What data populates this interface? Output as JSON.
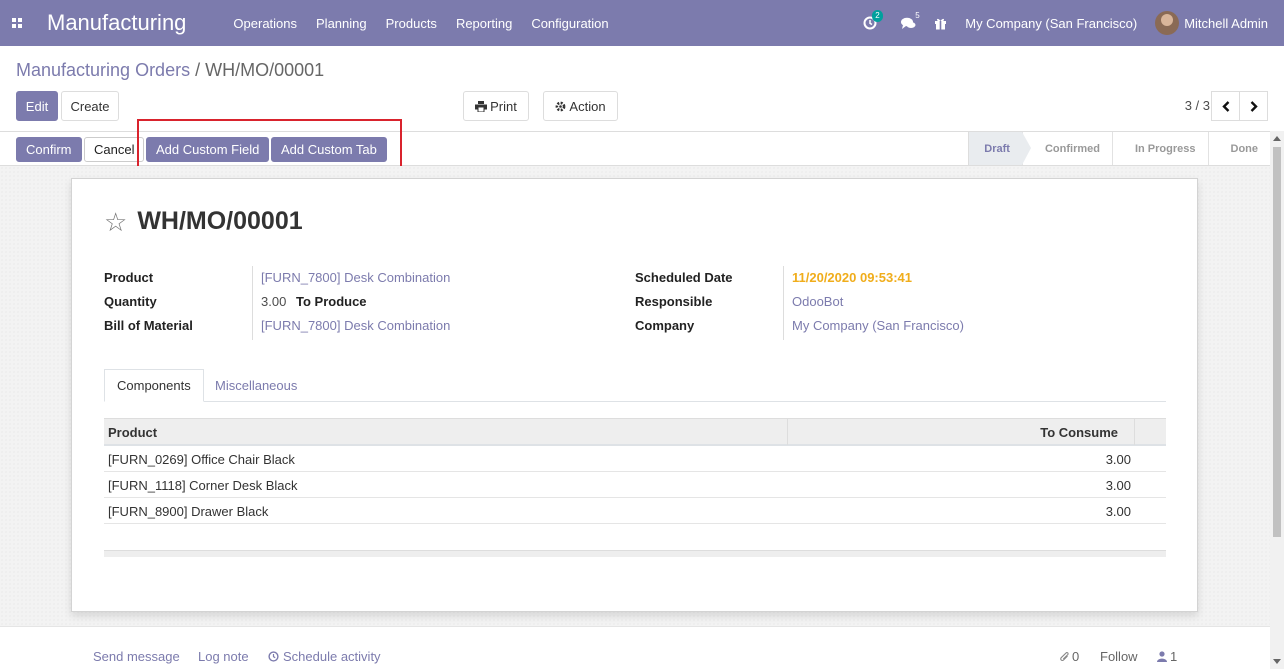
{
  "navbar": {
    "app_title": "Manufacturing",
    "menu": [
      "Operations",
      "Planning",
      "Products",
      "Reporting",
      "Configuration"
    ],
    "activity_count": "2",
    "messages_count": "5",
    "company": "My Company (San Francisco)",
    "user": "Mitchell Admin"
  },
  "breadcrumb": {
    "parent": "Manufacturing Orders",
    "separator": "/",
    "current": "WH/MO/00001"
  },
  "control_panel": {
    "edit_label": "Edit",
    "create_label": "Create",
    "print_label": "Print",
    "action_label": "Action",
    "pager_value": "3 / 3"
  },
  "statusbar": {
    "confirm_label": "Confirm",
    "cancel_label": "Cancel",
    "add_custom_field_label": "Add Custom Field",
    "add_custom_tab_label": "Add Custom Tab",
    "stages": [
      "Draft",
      "Confirmed",
      "In Progress",
      "Done"
    ],
    "active_stage": "Draft"
  },
  "record": {
    "title": "WH/MO/00001",
    "left_fields": [
      {
        "label": "Product",
        "value": "[FURN_7800] Desk Combination"
      },
      {
        "label": "Quantity",
        "value": "3.00",
        "suffix": "To Produce"
      },
      {
        "label": "Bill of Material",
        "value": "[FURN_7800] Desk Combination"
      }
    ],
    "right_fields": [
      {
        "label": "Scheduled Date",
        "value": "11/20/2020 09:53:41"
      },
      {
        "label": "Responsible",
        "value": "OdooBot"
      },
      {
        "label": "Company",
        "value": "My Company (San Francisco)"
      }
    ]
  },
  "tabs": [
    "Components",
    "Miscellaneous"
  ],
  "components_table": {
    "columns": [
      "Product",
      "To Consume"
    ],
    "rows": [
      {
        "product": "[FURN_0269] Office Chair Black",
        "to_consume": "3.00"
      },
      {
        "product": "[FURN_1118] Corner Desk Black",
        "to_consume": "3.00"
      },
      {
        "product": "[FURN_8900] Drawer Black",
        "to_consume": "3.00"
      }
    ]
  },
  "chatter": {
    "send_message": "Send message",
    "log_note": "Log note",
    "schedule_activity": "Schedule activity",
    "attachments_count": "0",
    "follow_label": "Follow",
    "followers_count": "1"
  },
  "colors": {
    "brand": "#7c7bad",
    "date_warning": "#f0ad1b",
    "highlight_box": "#d9232d"
  }
}
